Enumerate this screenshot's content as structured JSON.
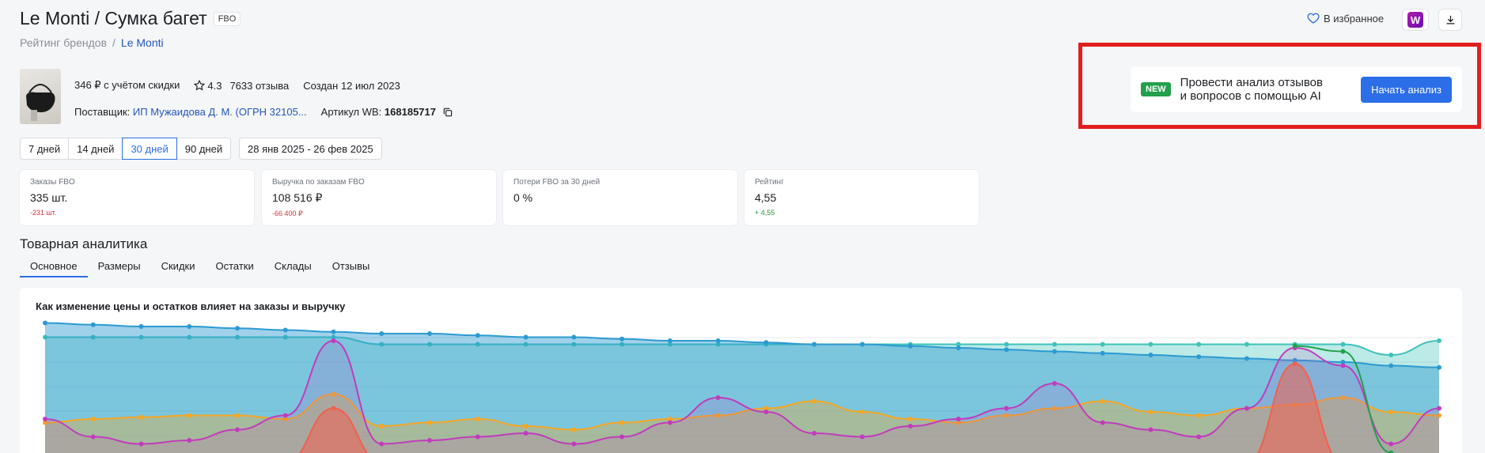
{
  "header": {
    "title": "Le Monti / Сумка багет",
    "title_badge": "FBO",
    "favorites_label": "В избранное",
    "wb_logo_letter": "W"
  },
  "breadcrumb": {
    "root": "Рейтинг брендов",
    "separator": "/",
    "current": "Le Monti"
  },
  "product": {
    "price": "346 ₽ с учётом скидки",
    "rating": "4.3",
    "reviews": "7633 отзыва",
    "created": "Создан 12 июл 2023",
    "supplier_label": "Поставщик:",
    "supplier_name": "ИП Мужаидова Д. М. (ОГРН 32105...",
    "article_label": "Артикул WB:",
    "article_value": "168185717"
  },
  "periods": {
    "items": [
      "7 дней",
      "14 дней",
      "30 дней",
      "90 дней"
    ],
    "active_index": 2,
    "date_range": "28 янв 2025 - 26 фев 2025"
  },
  "stats": [
    {
      "label": "Заказы FBO",
      "value": "335 шт.",
      "delta": "-231 шт.",
      "trend": "neg"
    },
    {
      "label": "Выручка по заказам FBO",
      "value": "108 516 ₽",
      "delta": "-66 400 ₽",
      "trend": "neg"
    },
    {
      "label": "Потери FBO за 30 дней",
      "value": "0 %",
      "delta": "",
      "trend": ""
    },
    {
      "label": "Рейтинг",
      "value": "4,55",
      "delta": "+ 4,55",
      "trend": "pos"
    }
  ],
  "analytics": {
    "section_title": "Товарная аналитика",
    "tabs": [
      "Основное",
      "Размеры",
      "Скидки",
      "Остатки",
      "Склады",
      "Отзывы"
    ],
    "active_tab": 0
  },
  "chart": {
    "title": "Как изменение цены и остатков влияет на заказы и выручку"
  },
  "ai_promo": {
    "badge": "NEW",
    "text_line1": "Провести анализ отзывов",
    "text_line2": "и вопросов с помощью AI",
    "button": "Начать анализ"
  },
  "colors": {
    "accent": "#2c6ee8",
    "link": "#2456b8",
    "negative": "#d4333a",
    "positive": "#1f9d3a",
    "highlight_frame": "#e21e1e",
    "series_teal": "#3fc2bb",
    "series_blue": "#2c9ad1",
    "series_magenta": "#c23bbd",
    "series_orange": "#f5a623",
    "series_red": "#f0614f",
    "series_green": "#22a04b"
  },
  "chart_data": {
    "type": "area",
    "title": "Как изменение цены и остатков влияет на заказы и выручку",
    "x_count": 30,
    "grid": true,
    "series": [
      {
        "color": "#3fc2bb",
        "values": [
          70,
          70,
          70,
          70,
          70,
          70,
          70,
          66,
          66,
          66,
          66,
          66,
          66,
          66,
          66,
          66,
          66,
          66,
          66,
          66,
          66,
          66,
          66,
          66,
          66,
          66,
          66,
          66,
          60,
          68
        ]
      },
      {
        "color": "#2c9ad1",
        "values": [
          78,
          77,
          76,
          76,
          75,
          74,
          73,
          72,
          72,
          71,
          70,
          70,
          69,
          68,
          68,
          67,
          66,
          66,
          65,
          64,
          63,
          62,
          61,
          60,
          59,
          58,
          57,
          56,
          54,
          53
        ]
      },
      {
        "color": "#f5a623",
        "values": [
          22,
          24,
          25,
          26,
          26,
          24,
          38,
          20,
          22,
          24,
          20,
          18,
          22,
          24,
          26,
          30,
          34,
          28,
          24,
          22,
          26,
          30,
          34,
          28,
          26,
          30,
          32,
          36,
          28,
          26
        ]
      },
      {
        "color": "#c23bbd",
        "values": [
          24,
          14,
          10,
          12,
          18,
          26,
          68,
          10,
          12,
          14,
          16,
          10,
          14,
          22,
          36,
          28,
          16,
          14,
          20,
          24,
          30,
          44,
          22,
          18,
          14,
          30,
          64,
          54,
          10,
          30
        ]
      },
      {
        "color": "#f0614f",
        "values": [
          0,
          0,
          0,
          0,
          0,
          0,
          30,
          0,
          0,
          0,
          0,
          0,
          0,
          0,
          0,
          0,
          0,
          0,
          0,
          0,
          0,
          0,
          0,
          0,
          0,
          0,
          55,
          0,
          0,
          0
        ]
      },
      {
        "color": "#22a04b",
        "values": [
          null,
          null,
          null,
          null,
          null,
          null,
          null,
          null,
          null,
          null,
          null,
          null,
          null,
          null,
          null,
          null,
          null,
          null,
          null,
          null,
          null,
          null,
          null,
          null,
          null,
          null,
          65,
          62,
          5,
          null
        ]
      }
    ]
  }
}
